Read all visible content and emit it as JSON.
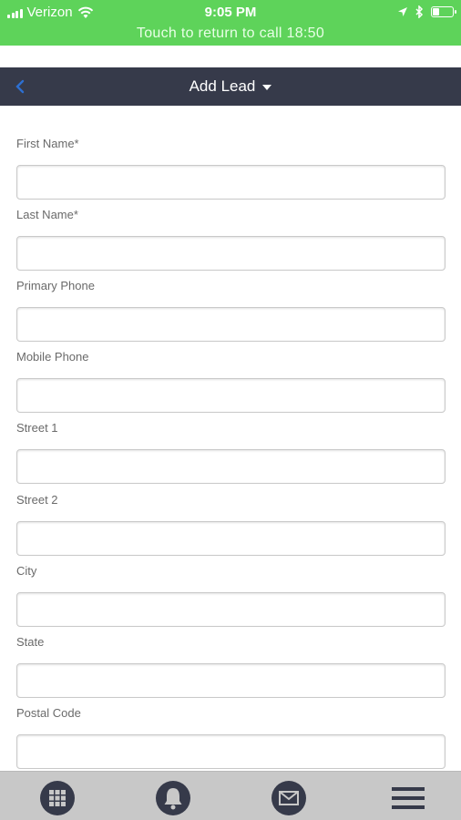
{
  "status_bar": {
    "carrier": "Verizon",
    "time": "9:05 PM",
    "call_banner": "Touch to return to call 18:50"
  },
  "nav": {
    "title": "Add Lead"
  },
  "form": {
    "fields": [
      {
        "label": "First Name*",
        "value": ""
      },
      {
        "label": "Last Name*",
        "value": ""
      },
      {
        "label": "Primary Phone",
        "value": ""
      },
      {
        "label": "Mobile Phone",
        "value": ""
      },
      {
        "label": "Street 1",
        "value": ""
      },
      {
        "label": "Street 2",
        "value": ""
      },
      {
        "label": "City",
        "value": ""
      },
      {
        "label": "State",
        "value": ""
      },
      {
        "label": "Postal Code",
        "value": ""
      }
    ]
  },
  "tab_bar": {
    "items": [
      "grid-icon",
      "bell-icon",
      "mail-icon",
      "menu-icon"
    ]
  },
  "colors": {
    "status_bar": "#5ed35a",
    "nav_bar": "#363a4a",
    "tab_bar": "#c8c8c8",
    "icon": "#363a4a",
    "back_arrow": "#2d6fd1"
  }
}
